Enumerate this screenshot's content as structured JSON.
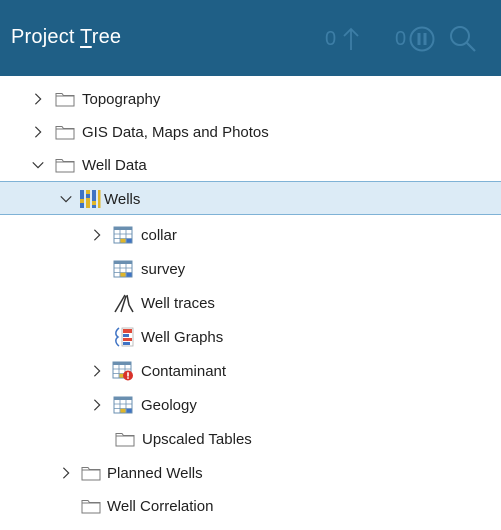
{
  "panel": {
    "title_before": "Project ",
    "title_mnemonic": "T",
    "title_after": "ree",
    "filter_count": "0",
    "pause_count": "0"
  },
  "tree": {
    "topography": "Topography",
    "gis": "GIS Data, Maps and Photos",
    "well_data": "Well Data",
    "wells": "Wells",
    "collar": "collar",
    "survey": "survey",
    "well_traces": "Well traces",
    "well_graphs": "Well Graphs",
    "contaminant": "Contaminant",
    "geology": "Geology",
    "upscaled_tables": "Upscaled Tables",
    "planned_wells": "Planned Wells",
    "well_correlation": "Well Correlation"
  },
  "icons": {
    "folder": "folder-icon",
    "wells": "wells-icon",
    "table": "table-icon",
    "traces": "well-traces-icon",
    "graphs": "well-graphs-icon",
    "error": "error-badge-icon"
  },
  "colors": {
    "header_bg": "#1f5f86",
    "header_controls": "#3d7ea6",
    "selection_bg": "#dcebf6",
    "selection_border": "#7fb2d6"
  }
}
